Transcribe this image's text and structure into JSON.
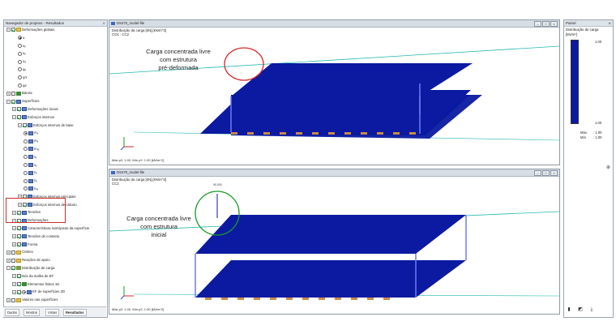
{
  "navigator": {
    "title": "Navegador de projetos - Resultados",
    "pin": "⨯",
    "tree": [
      {
        "label": "Deformações globais",
        "indent": 0,
        "exp": "−",
        "chk": "on",
        "icon": "fold"
      },
      {
        "label": "u",
        "indent": 2,
        "rad": "on",
        "icon": "none"
      },
      {
        "label": "uₓ",
        "indent": 2,
        "rad": "off"
      },
      {
        "label": "uᵧ",
        "indent": 2,
        "rad": "off"
      },
      {
        "label": "uₔ",
        "indent": 2,
        "rad": "off"
      },
      {
        "label": "φₓ",
        "indent": 2,
        "rad": "off"
      },
      {
        "label": "φY",
        "indent": 2,
        "rad": "off"
      },
      {
        "label": "φz",
        "indent": 2,
        "rad": "off"
      },
      {
        "label": "Barras",
        "indent": 0,
        "exp": "+",
        "chk": "off",
        "icon": "bar"
      },
      {
        "label": "Superfícies",
        "indent": 0,
        "exp": "−",
        "chk": "on",
        "icon": "surf"
      },
      {
        "label": "Deformações locais",
        "indent": 1,
        "exp": "+",
        "chk": "on",
        "icon": "surf"
      },
      {
        "label": "Esforços internos",
        "indent": 1,
        "exp": "−",
        "chk": "on",
        "icon": "surf"
      },
      {
        "label": "Esforços internos de base",
        "indent": 2,
        "exp": "−",
        "chk": "on",
        "icon": "surf"
      },
      {
        "label": "mₓ",
        "indent": 3,
        "rad": "on",
        "icon": "surf"
      },
      {
        "label": "mᵧ",
        "indent": 3,
        "rad": "off",
        "icon": "surf"
      },
      {
        "label": "mₓᵧ",
        "indent": 3,
        "rad": "off",
        "icon": "surf"
      },
      {
        "label": "vₓ",
        "indent": 3,
        "rad": "off",
        "icon": "surf"
      },
      {
        "label": "vᵧ",
        "indent": 3,
        "rad": "off",
        "icon": "surf"
      },
      {
        "label": "nₓ",
        "indent": 3,
        "rad": "off",
        "icon": "surf"
      },
      {
        "label": "nᵧ",
        "indent": 3,
        "rad": "off",
        "icon": "surf"
      },
      {
        "label": "nₓᵧ",
        "indent": 3,
        "rad": "off",
        "icon": "surf"
      },
      {
        "label": "Esforços internos principais",
        "indent": 2,
        "exp": "+",
        "chk": "on",
        "icon": "surf"
      },
      {
        "label": "Esforços internos de cálculo",
        "indent": 2,
        "exp": "+",
        "chk": "on",
        "icon": "surf"
      },
      {
        "label": "Tensões",
        "indent": 1,
        "exp": "+",
        "chk": "on",
        "icon": "surf"
      },
      {
        "label": "Deformações",
        "indent": 1,
        "exp": "+",
        "chk": "on",
        "icon": "surf"
      },
      {
        "label": "Características isotrópicas da superfície",
        "indent": 1,
        "exp": "+",
        "chk": "on",
        "icon": "surf"
      },
      {
        "label": "Tensões de contacto",
        "indent": 1,
        "exp": "+",
        "chk": "on",
        "icon": "surf"
      },
      {
        "label": "Forma",
        "indent": 1,
        "exp": "+",
        "chk": "on",
        "icon": "surf"
      },
      {
        "label": "Critério",
        "indent": 0,
        "exp": "+",
        "chk": "off",
        "icon": "fold"
      },
      {
        "label": "Reações de apoio",
        "indent": 0,
        "exp": "+",
        "chk": "off",
        "icon": "fold"
      },
      {
        "label": "Distribuição de carga",
        "indent": 0,
        "exp": "−",
        "chk": "on",
        "icon": "dist"
      },
      {
        "label": "Nós da malha de EF",
        "indent": 1,
        "exp": "+",
        "chk": "on",
        "icon": "none"
      },
      {
        "label": "Elementos finitos 1D",
        "indent": 1,
        "exp": "+",
        "chk": "on",
        "icon": "bar"
      },
      {
        "label": "EF de superfícies 2D",
        "indent": 1,
        "exp": "+",
        "chk": "on",
        "rad": "on",
        "icon": "surf"
      },
      {
        "label": "Valores nas superfícies",
        "indent": 0,
        "exp": "+",
        "chk": "off",
        "icon": "fold"
      }
    ],
    "tabs": [
      "Dados",
      "Mostrar",
      "Vistas",
      "Resultados"
    ]
  },
  "view_top": {
    "title": "DS470_model-file",
    "info_line1": "Distribuição da carga [kN],[kN/m^2]",
    "info_line2": "CO1 : CC2",
    "footer": "Máx p2: 1.00, Mín p2: 1.00 [kN/m^2]",
    "callout": [
      "Carga concentrada livre",
      "com estrutura",
      "pré-deformada"
    ],
    "label_value": "1.000"
  },
  "view_bottom": {
    "title": "DS470_model-file",
    "info_line1": "Distribuição da carga [kN],[kN/m^2]",
    "info_line2": "CC2",
    "footer": "Máx p2: 1.00, Mín p2: 1.00 [kN/m^2]",
    "callout": [
      "Carga concentrada livre",
      "com estrutura",
      "inicial"
    ],
    "label_value": "90.000"
  },
  "panel": {
    "title": "Painel",
    "heading": "Distribuição de carga",
    "unit": "[kN/m²]",
    "tick_top": "1.00",
    "tick_bottom": "1.00",
    "max_label": "Máx",
    "max_value": ": 1.00",
    "min_label": "Mín",
    "min_value": ": 1.00"
  },
  "colors": {
    "surface": "#0b1aa0",
    "highlight_red": "#d12a2a",
    "highlight_green": "#1a9a2a",
    "axis_cyan": "#23b8b0"
  }
}
